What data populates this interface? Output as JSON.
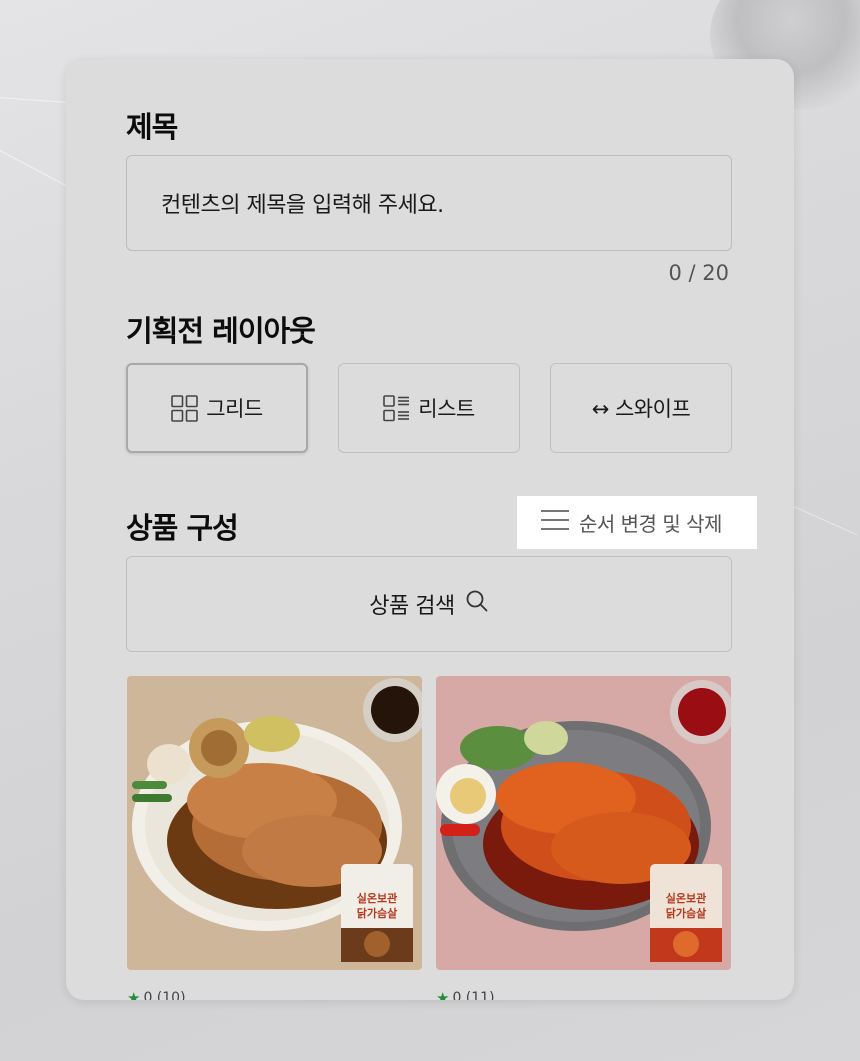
{
  "title_section": {
    "heading": "제목",
    "input_placeholder": "컨텐츠의 제목을 입력해 주세요.",
    "counter": "0 / 20"
  },
  "layout_section": {
    "heading": "기획전 레이아웃",
    "options": [
      {
        "label": "그리드",
        "icon": "grid-icon",
        "selected": true
      },
      {
        "label": "리스트",
        "icon": "list-icon",
        "selected": false
      },
      {
        "label": "↔ 스와이프",
        "icon": "swipe-icon",
        "selected": false
      }
    ]
  },
  "product_section": {
    "heading": "상품 구성",
    "order_button_label": "순서 변경 및 삭제",
    "search_label": "상품 검색",
    "products": [
      {
        "package_text": "실온보관 닭가슴살",
        "rating": "0 (10)"
      },
      {
        "package_text": "실온보관 닭가슴살",
        "rating": "0 (11)"
      }
    ]
  },
  "colors": {
    "card_bg": "#dcdcdc",
    "border": "#c0c0c0",
    "star": "#1f8f3a",
    "order_button_bg": "#ffffff"
  }
}
